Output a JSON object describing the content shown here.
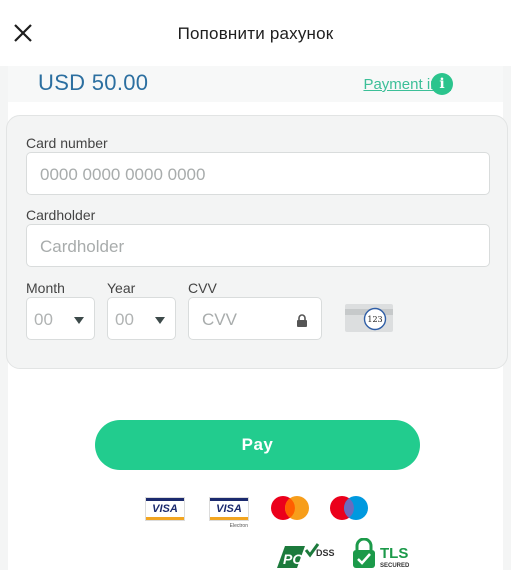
{
  "header": {
    "title": "Поповнити рахунок"
  },
  "amount_bar": {
    "amount": "USD 50.00",
    "payment_info_label": "Payment info",
    "info_icon_glyph": "i"
  },
  "form": {
    "card_number": {
      "label": "Card number",
      "placeholder": "0000 0000 0000 0000"
    },
    "cardholder": {
      "label": "Cardholder",
      "placeholder": "Cardholder"
    },
    "month": {
      "label": "Month",
      "value": "00"
    },
    "year": {
      "label": "Year",
      "value": "00"
    },
    "cvv": {
      "label": "CVV",
      "placeholder": "CVV",
      "card_hint": "123"
    }
  },
  "pay_button": {
    "label": "Pay"
  },
  "logos": {
    "visa": "VISA",
    "visa_electron": "VISA",
    "visa_electron_sub": "Electron",
    "pci_dss": "PCI DSS",
    "tls": "TLS",
    "tls_sub": "SECURED"
  },
  "colors": {
    "accent": "#22cc8e",
    "amount_text": "#2c6fa0",
    "link": "#3cbf98",
    "mastercard_red": "#eb001b",
    "mastercard_orange": "#f79e1b",
    "maestro_blue": "#0099df"
  }
}
